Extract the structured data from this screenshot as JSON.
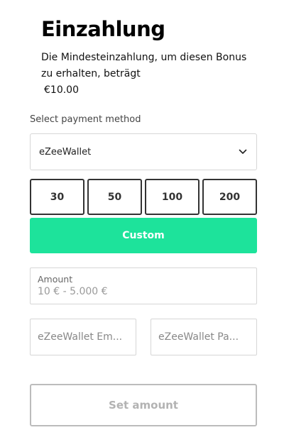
{
  "header": {
    "title": "Einzahlung",
    "bonus_text": "Die Mindesteinzahlung, um diesen Bonus zu erhalten, beträgt",
    "bonus_amount": "€10.00"
  },
  "payment": {
    "label": "Select payment method",
    "selected": "eZeeWallet"
  },
  "presets": [
    "30",
    "50",
    "100",
    "200"
  ],
  "custom_label": "Custom",
  "amount": {
    "label": "Amount",
    "placeholder": "10 € - 5.000 €"
  },
  "fields": {
    "email_placeholder": "eZeeWallet Em...",
    "password_placeholder": "eZeeWallet Pa..."
  },
  "submit_label": "Set amount",
  "colors": {
    "accent": "#1de39b",
    "preset_border": "#333333",
    "disabled_text": "#b3b3b3"
  }
}
